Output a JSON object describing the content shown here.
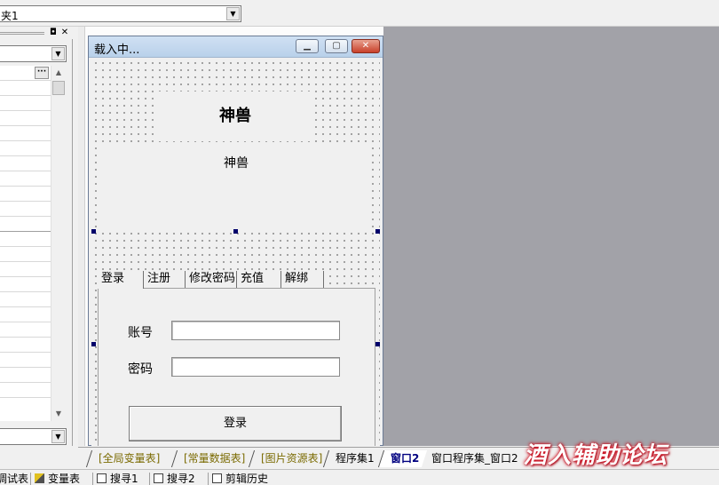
{
  "top": {
    "combo_value": "夹1"
  },
  "left_panel": {
    "pin_glyph": "◘",
    "close_glyph": "✕",
    "ellipsis": "···",
    "row_count": 22
  },
  "form": {
    "title": "载入中...",
    "banner_title": "神兽",
    "banner_subtitle": "神兽",
    "tabs": [
      {
        "label": "登录",
        "active": true
      },
      {
        "label": "注册",
        "active": false
      },
      {
        "label": "修改密码",
        "active": false
      },
      {
        "label": "充值",
        "active": false
      },
      {
        "label": "解绑",
        "active": false
      }
    ],
    "account_label": "账号",
    "password_label": "密码",
    "account_value": "",
    "password_value": "",
    "login_button": "登录"
  },
  "bottom_tabs": [
    {
      "label": "[全局变量表]",
      "kind": "green"
    },
    {
      "label": "[常量数据表]",
      "kind": "green"
    },
    {
      "label": "[图片资源表]",
      "kind": "green"
    },
    {
      "label": "程序集1",
      "kind": "normal"
    },
    {
      "label": "窗口2",
      "kind": "active"
    },
    {
      "label": "窗口程序集_窗口2",
      "kind": "normal"
    }
  ],
  "status_items": [
    {
      "label": "调试表",
      "icon": "doc-icon"
    },
    {
      "label": "变量表",
      "icon": "variable-icon"
    },
    {
      "label": "搜寻1",
      "icon": "doc-icon"
    },
    {
      "label": "搜寻2",
      "icon": "doc-icon"
    },
    {
      "label": "剪辑历史",
      "icon": "doc-icon"
    }
  ],
  "watermark": "酒入辅助论坛",
  "colors": {
    "designer_bg": "#a2a2a8",
    "title_bar": "#c4d8ee",
    "close_button": "#c8402a",
    "active_tab_text": "#000080",
    "watermark_glow": "#d01020"
  }
}
